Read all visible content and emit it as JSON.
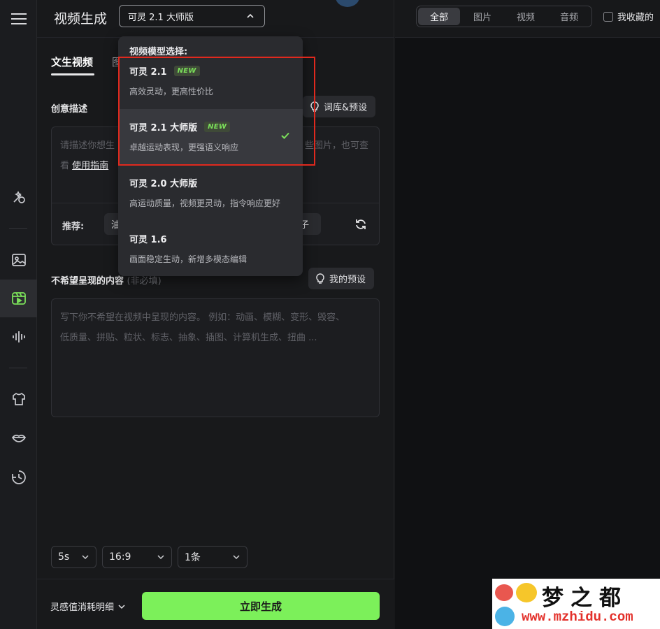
{
  "header": {
    "title": "视频生成",
    "model_selected": "可灵 2.1 大师版"
  },
  "tabs": {
    "active": "文生视频",
    "next_partial": "图"
  },
  "creative": {
    "label": "创意描述",
    "library_button": "词库&预设",
    "placeholder_line1_start": "请描述你想生",
    "placeholder_line1_end": "些图片，也可查",
    "placeholder_line2_start": "看",
    "guide_link": "使用指南",
    "recommend_label": "推荐:",
    "rec_chip_1": "油",
    "rec_chip_2": "子"
  },
  "negative": {
    "label": "不希望呈现的内容",
    "optional": "(非必填)",
    "preset_button": "我的预设",
    "placeholder_line1": "写下你不希望在视频中呈现的内容。 例如：动画、模糊、变形、毁容、",
    "placeholder_line2": "低质量、拼贴、粒状、标志、抽象、插图、计算机生成、扭曲 ..."
  },
  "settings": {
    "duration": "5s",
    "ratio": "16:9",
    "count": "1条"
  },
  "footer": {
    "cost_link": "灵感值消耗明细",
    "generate_button": "立即生成"
  },
  "right_header": {
    "filters": [
      "全部",
      "图片",
      "视频",
      "音频"
    ],
    "active_filter": "全部",
    "favorites": "我收藏的"
  },
  "dropdown": {
    "heading": "视频模型选择:",
    "options": [
      {
        "name": "可灵 2.1",
        "badge": "NEW",
        "desc": "高效灵动，更高性价比"
      },
      {
        "name": "可灵 2.1 大师版",
        "badge": "NEW",
        "desc": "卓越运动表现，更强语义响应"
      },
      {
        "name": "可灵 2.0 大师版",
        "badge": "",
        "desc": "高运动质量，视频更灵动，指令响应更好"
      },
      {
        "name": "可灵 1.6",
        "badge": "",
        "desc": "画面稳定生动，新增多模态编辑"
      }
    ],
    "selected_index": 1
  },
  "watermark": {
    "title": "梦之都",
    "url": "www.mzhidu.com"
  },
  "colors": {
    "accent_green": "#7cf05a",
    "highlight_red": "#e0291e"
  }
}
